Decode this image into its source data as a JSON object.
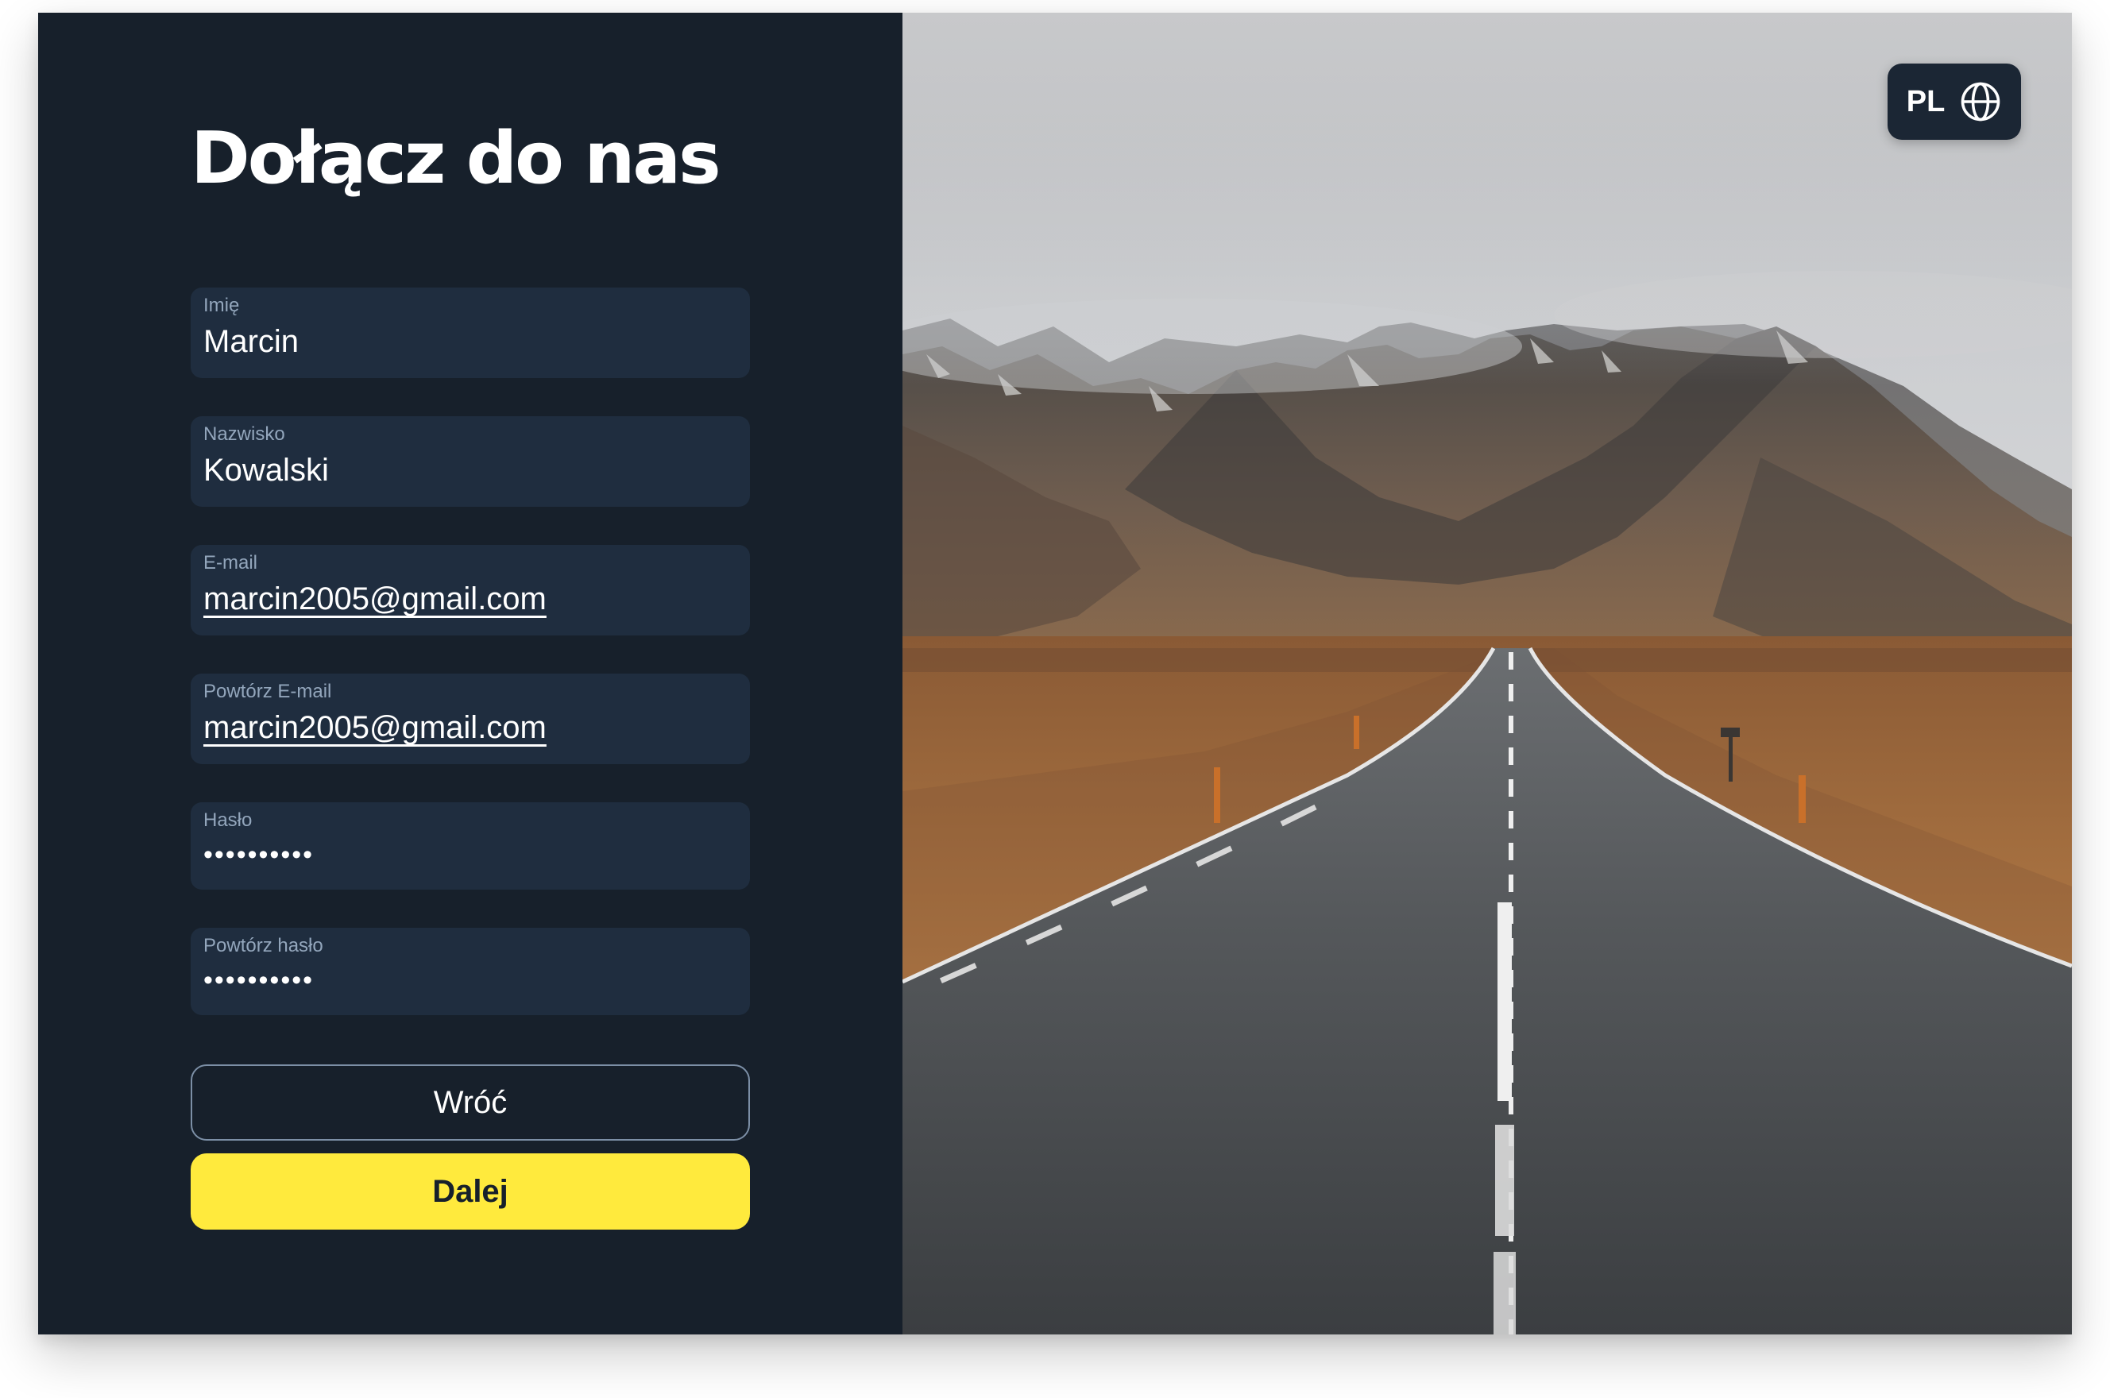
{
  "form": {
    "title": "Dołącz do nas",
    "fields": [
      {
        "label": "Imię",
        "value": "Marcin"
      },
      {
        "label": "Nazwisko",
        "value": "Kowalski"
      },
      {
        "label": "E-mail",
        "value": "marcin2005@gmail.com"
      },
      {
        "label": "Powtórz E-mail",
        "value": "marcin2005@gmail.com"
      },
      {
        "label": "Hasło",
        "value": "••••••••••"
      },
      {
        "label": "Powtórz hasło",
        "value": "••••••••••"
      }
    ],
    "back_label": "Wróć",
    "next_label": "Dalej"
  },
  "language": {
    "code": "PL",
    "icon": "globe-icon"
  },
  "colors": {
    "panel_bg": "#17202b",
    "field_bg": "#1f2d3f",
    "accent": "#ffea3d"
  }
}
